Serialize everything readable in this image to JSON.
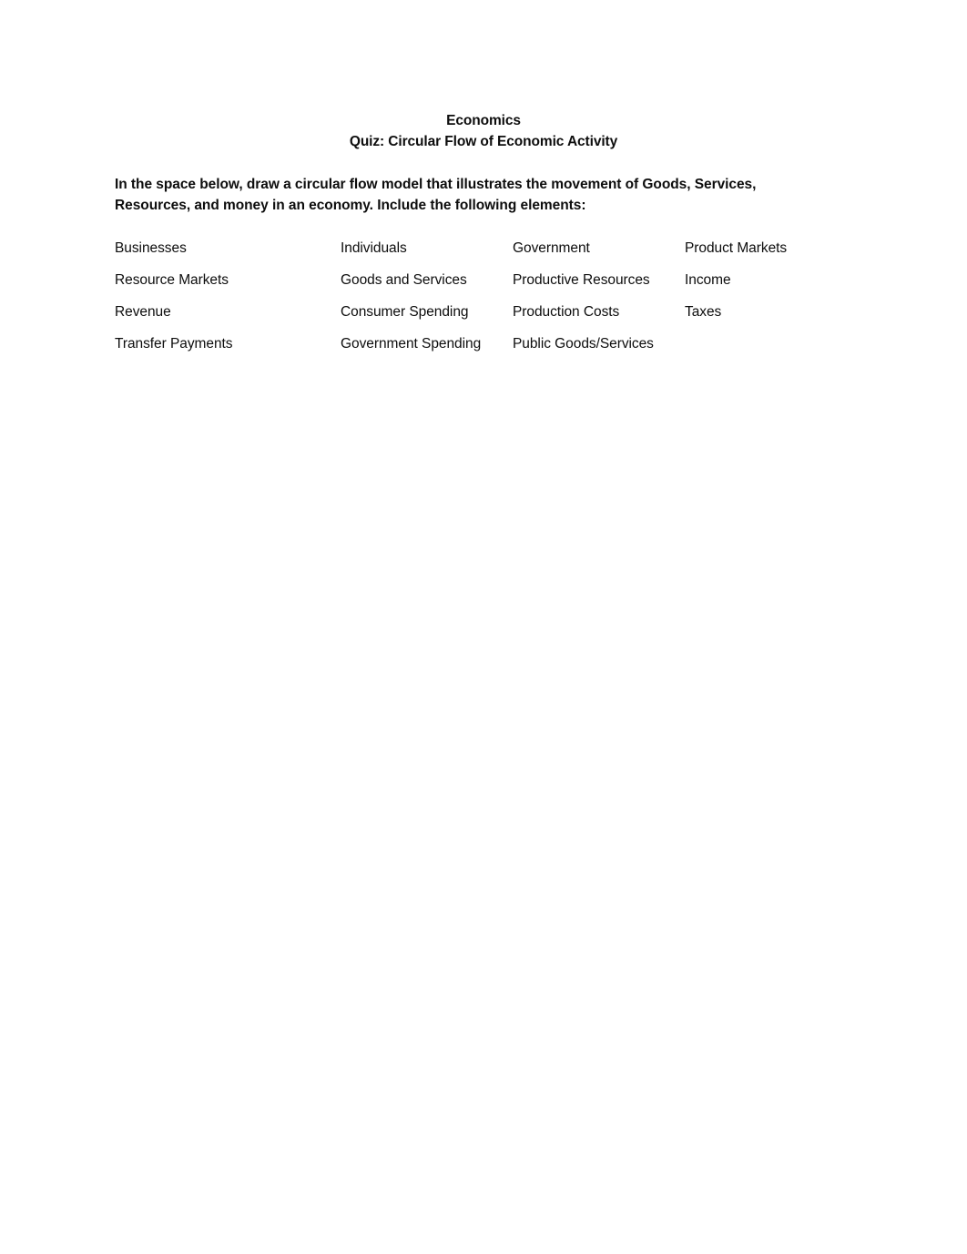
{
  "document": {
    "title": "Economics",
    "subtitle": "Quiz: Circular Flow of Economic Activity",
    "text_color": "#0d0d0d",
    "background_color": "#ffffff"
  },
  "instructions": {
    "line1": "In the space below, draw a circular flow model that illustrates the movement of Goods, Services,",
    "line2": "Resources, and money in an economy.  Include the following elements:"
  },
  "element_list": {
    "rows": [
      {
        "cells": [
          "Businesses",
          "Individuals",
          "Government",
          "Product Markets"
        ]
      },
      {
        "cells": [
          "Resource Markets",
          "Goods and Services",
          "Productive Resources",
          "Income"
        ]
      },
      {
        "cells": [
          "Revenue",
          "Consumer Spending",
          "Production Costs",
          "Taxes"
        ]
      },
      {
        "cells": [
          "Transfer Payments",
          "Government Spending",
          "Public Goods/Services",
          ""
        ]
      }
    ]
  },
  "answer_area": {
    "label": ""
  }
}
